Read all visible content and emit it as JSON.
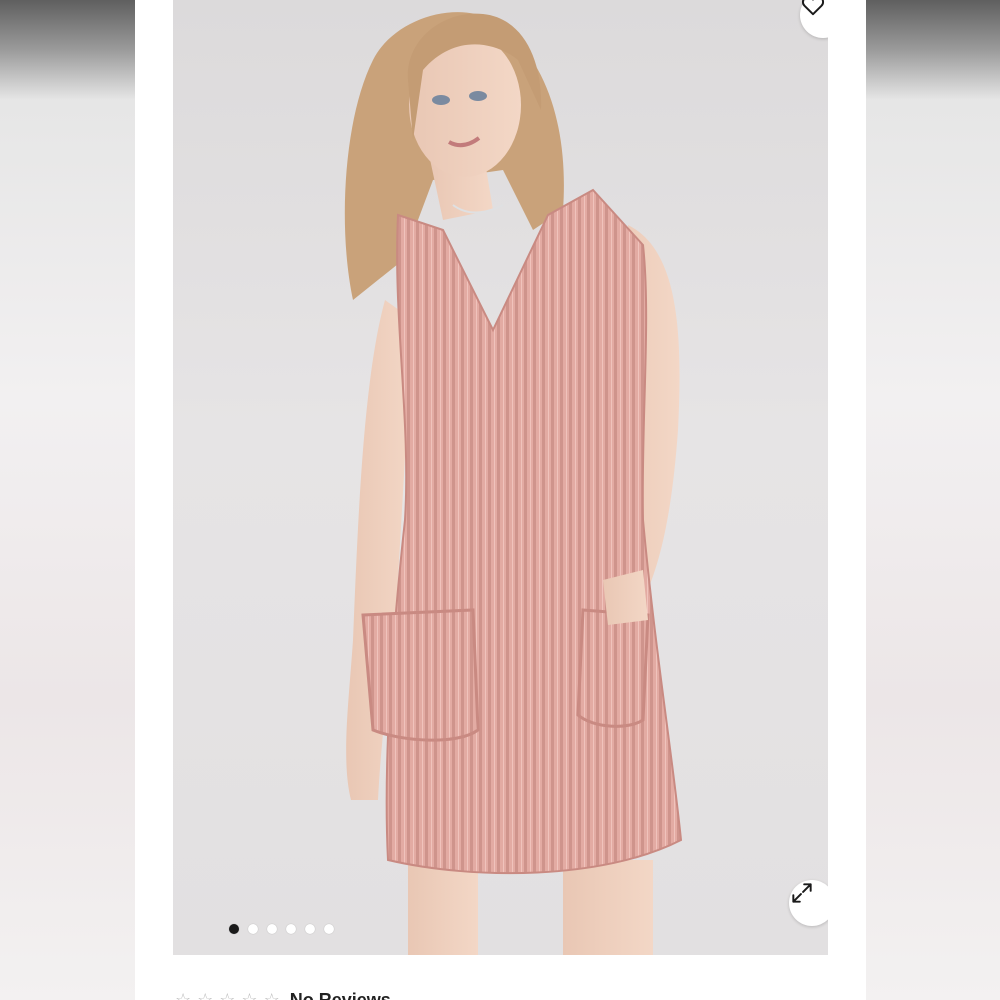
{
  "product": {
    "image_count": 6,
    "active_image_index": 0,
    "rating_stars": 0,
    "rating_text": "No Reviews"
  },
  "icons": {
    "favorite": "heart-icon",
    "expand": "expand-arrows-icon"
  },
  "colors": {
    "dress": "#e3aba3",
    "active_dot": "#1a1a1a",
    "inactive_dot": "#ffffff"
  }
}
